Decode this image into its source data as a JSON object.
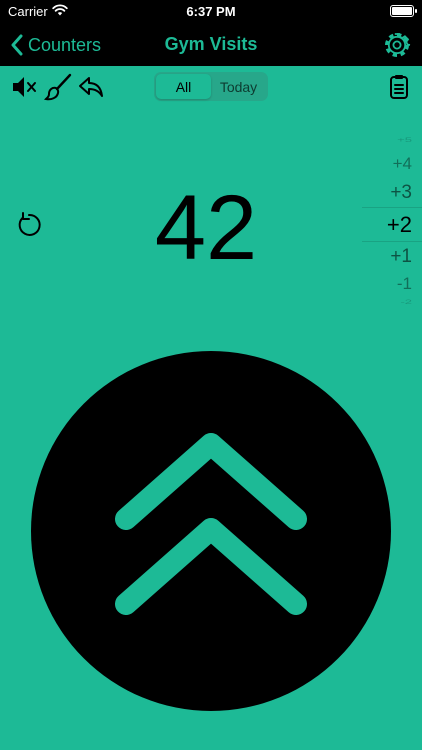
{
  "status_bar": {
    "carrier": "Carrier",
    "time": "6:37 PM"
  },
  "nav": {
    "back_label": "Counters",
    "title": "Gym Visits"
  },
  "toolbar": {
    "segments": [
      "All",
      "Today"
    ],
    "selected_segment": "All"
  },
  "counter": {
    "value": "42"
  },
  "increment_picker": {
    "options": [
      "+5",
      "+4",
      "+3",
      "+2",
      "+1",
      "-1",
      "-2"
    ],
    "selected": "+2"
  },
  "colors": {
    "accent": "#1dba96",
    "dark": "#000000",
    "segment_bg": "#27a78a"
  },
  "icons": [
    "wifi-icon",
    "battery-icon",
    "chevron-left-icon",
    "gear-icon",
    "mute-icon",
    "brush-icon",
    "undo-icon",
    "clipboard-icon",
    "reset-icon",
    "double-chevron-up-icon"
  ]
}
